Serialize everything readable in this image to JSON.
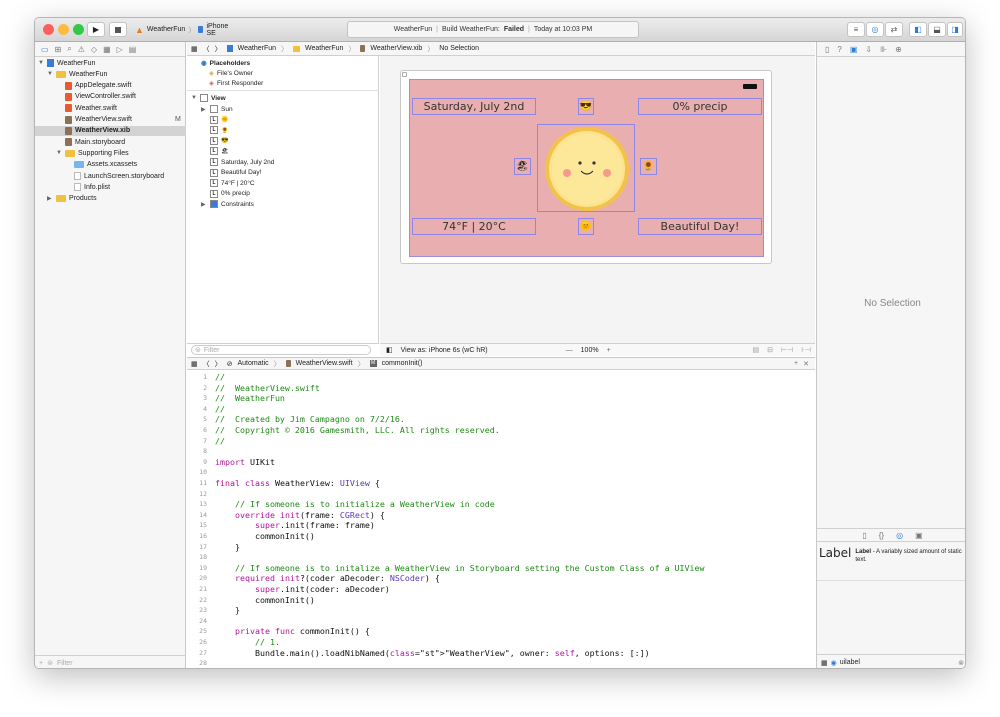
{
  "toolbar": {
    "scheme_project": "WeatherFun",
    "scheme_device": "iPhone SE",
    "status_project": "WeatherFun",
    "status_build": "Build WeatherFun:",
    "status_result": "Failed",
    "status_time": "Today at 10:03 PM"
  },
  "navigator": {
    "items": [
      {
        "label": "WeatherFun",
        "kind": "project",
        "indent": 0,
        "disc": "▼"
      },
      {
        "label": "WeatherFun",
        "kind": "folder",
        "indent": 1,
        "disc": "▼"
      },
      {
        "label": "AppDelegate.swift",
        "kind": "swift",
        "indent": 2,
        "disc": ""
      },
      {
        "label": "ViewController.swift",
        "kind": "swift",
        "indent": 2,
        "disc": ""
      },
      {
        "label": "Weather.swift",
        "kind": "swift",
        "indent": 2,
        "disc": ""
      },
      {
        "label": "WeatherView.swift",
        "kind": "xib",
        "indent": 2,
        "disc": "",
        "badge": "M"
      },
      {
        "label": "WeatherView.xib",
        "kind": "xib",
        "indent": 2,
        "disc": "",
        "selected": true
      },
      {
        "label": "Main.storyboard",
        "kind": "xib",
        "indent": 2,
        "disc": ""
      },
      {
        "label": "Supporting Files",
        "kind": "folder",
        "indent": 2,
        "disc": "▼"
      },
      {
        "label": "Assets.xcassets",
        "kind": "folder",
        "indent": 3,
        "disc": ""
      },
      {
        "label": "LaunchScreen.storyboard",
        "kind": "doc",
        "indent": 3,
        "disc": ""
      },
      {
        "label": "Info.plist",
        "kind": "doc",
        "indent": 3,
        "disc": ""
      },
      {
        "label": "Products",
        "kind": "folder",
        "indent": 1,
        "disc": "▶"
      }
    ],
    "filter_placeholder": "Filter"
  },
  "jumpbar": [
    "WeatherFun",
    "WeatherFun",
    "WeatherView.xib",
    "No Selection"
  ],
  "outline": {
    "placeholders_header": "Placeholders",
    "files_owner": "File's Owner",
    "first_responder": "First Responder",
    "view": "View",
    "rows": [
      {
        "label": "Sun",
        "icon": "V",
        "indent": 2
      },
      {
        "label": "",
        "icon": "L",
        "indent": 2,
        "emoji": "🌞"
      },
      {
        "label": "",
        "icon": "L",
        "indent": 2,
        "emoji": "🌻"
      },
      {
        "label": "",
        "icon": "L",
        "indent": 2,
        "emoji": "😎"
      },
      {
        "label": "",
        "icon": "L",
        "indent": 2,
        "emoji": "🏖"
      },
      {
        "label": "Saturday, July 2nd",
        "icon": "L",
        "indent": 2
      },
      {
        "label": "Beautiful Day!",
        "icon": "L",
        "indent": 2
      },
      {
        "label": "74°F  |  20°C",
        "icon": "L",
        "indent": 2
      },
      {
        "label": "0% precip",
        "icon": "L",
        "indent": 2
      },
      {
        "label": "Constraints",
        "icon": "C",
        "indent": 2
      }
    ],
    "filter_placeholder": "Filter"
  },
  "weather": {
    "date": "Saturday, July 2nd",
    "precip": "0% precip",
    "temp": "74°F | 20°C",
    "mood": "Beautiful Day!",
    "icon_top": "😎",
    "icon_left": "🏖",
    "icon_right": "🌻",
    "icon_bottom": "🌞"
  },
  "canvas_footer": {
    "view_as": "View as: iPhone 6s (wC hR)",
    "zoom": "100%"
  },
  "code_jump": [
    "Automatic",
    "WeatherView.swift",
    "commonInit()"
  ],
  "code_lines": [
    {
      "n": "1",
      "t": "//",
      "c": "cm"
    },
    {
      "n": "2",
      "t": "//  WeatherView.swift",
      "c": "cm"
    },
    {
      "n": "3",
      "t": "//  WeatherFun",
      "c": "cm"
    },
    {
      "n": "4",
      "t": "//",
      "c": "cm"
    },
    {
      "n": "5",
      "t": "//  Created by Jim Campagno on 7/2/16.",
      "c": "cm"
    },
    {
      "n": "6",
      "t": "//  Copyright © 2016 Gamesmith, LLC. All rights reserved.",
      "c": "cm"
    },
    {
      "n": "7",
      "t": "//",
      "c": "cm"
    },
    {
      "n": "8",
      "t": "",
      "c": ""
    },
    {
      "n": "9",
      "t": "import UIKit",
      "c": "imp"
    },
    {
      "n": "10",
      "t": "",
      "c": ""
    },
    {
      "n": "11",
      "t": "final class WeatherView: UIView {",
      "c": "cls"
    },
    {
      "n": "12",
      "t": "",
      "c": ""
    },
    {
      "n": "13",
      "t": "    // If someone is to initialize a WeatherView in code",
      "c": "cm"
    },
    {
      "n": "14",
      "t": "    override init(frame: CGRect) {",
      "c": "ovr"
    },
    {
      "n": "15",
      "t": "        super.init(frame: frame)",
      "c": "sup"
    },
    {
      "n": "16",
      "t": "        commonInit()",
      "c": "call"
    },
    {
      "n": "17",
      "t": "    }",
      "c": ""
    },
    {
      "n": "18",
      "t": "",
      "c": ""
    },
    {
      "n": "19",
      "t": "    // If someone is to initalize a WeatherView in Storyboard setting the Custom Class of a UIView",
      "c": "cm"
    },
    {
      "n": "20",
      "t": "    required init?(coder aDecoder: NSCoder) {",
      "c": "req"
    },
    {
      "n": "21",
      "t": "        super.init(coder: aDecoder)",
      "c": "sup"
    },
    {
      "n": "22",
      "t": "        commonInit()",
      "c": "call"
    },
    {
      "n": "23",
      "t": "    }",
      "c": ""
    },
    {
      "n": "24",
      "t": "",
      "c": ""
    },
    {
      "n": "25",
      "t": "    private func commonInit() {",
      "c": "priv"
    },
    {
      "n": "26",
      "t": "        // 1.",
      "c": "cm"
    },
    {
      "n": "27",
      "t": "        Bundle.main().loadNibNamed(\"WeatherView\", owner: self, options: [:])",
      "c": "bun"
    },
    {
      "n": "28",
      "t": "",
      "c": ""
    }
  ],
  "inspector": {
    "no_selection": "No Selection",
    "lib_title": "Label",
    "lib_name": "Label",
    "lib_desc": "- A variably sized amount of static text.",
    "lib_filter": "uilabel"
  }
}
